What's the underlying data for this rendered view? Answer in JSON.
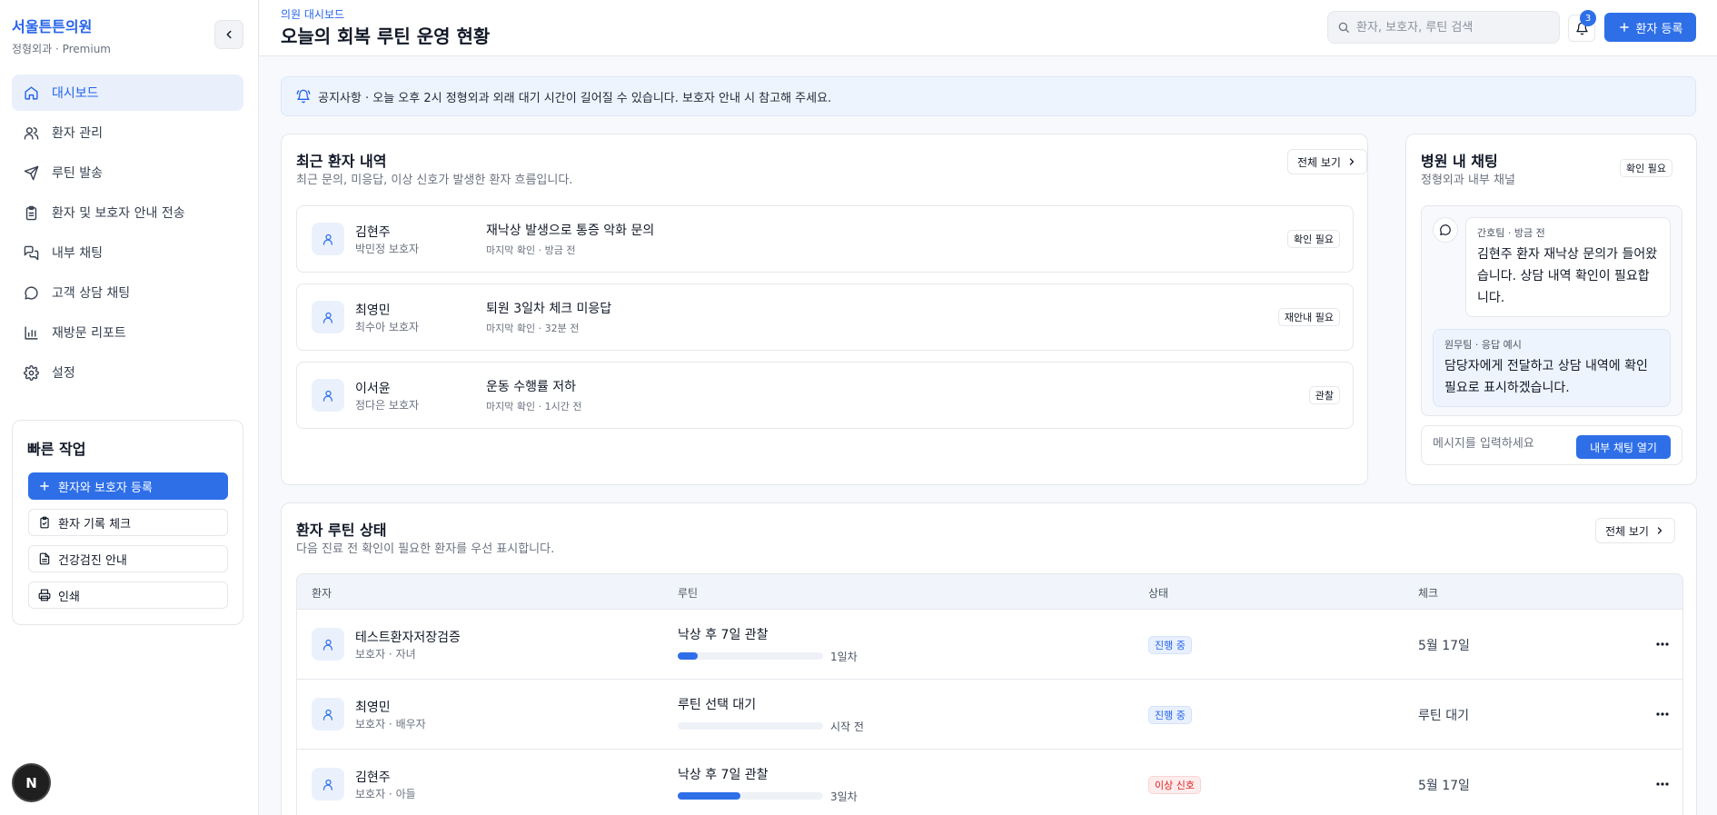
{
  "brand": {
    "name": "서울튼튼의원",
    "sub": "정형외과 · Premium"
  },
  "nav": [
    {
      "label": "대시보드",
      "icon": "home-icon"
    },
    {
      "label": "환자 관리",
      "icon": "users-icon"
    },
    {
      "label": "루틴 발송",
      "icon": "send-icon"
    },
    {
      "label": "환자 및 보호자 안내 전송",
      "icon": "clipboard-icon"
    },
    {
      "label": "내부 채팅",
      "icon": "chat-icon"
    },
    {
      "label": "고객 상담 채팅",
      "icon": "message-circle-icon"
    },
    {
      "label": "재방문 리포트",
      "icon": "bar-chart-icon"
    },
    {
      "label": "설정",
      "icon": "gear-icon"
    }
  ],
  "quick": {
    "title": "빠른 작업",
    "actions": [
      {
        "label": "환자와 보호자 등록",
        "icon": "plus-icon"
      },
      {
        "label": "환자 기록 체크",
        "icon": "clipboard-check-icon"
      },
      {
        "label": "건강검진 안내",
        "icon": "document-icon"
      },
      {
        "label": "인쇄",
        "icon": "printer-icon"
      }
    ]
  },
  "dev_badge": "N",
  "header": {
    "crumb": "의원 대시보드",
    "title": "오늘의 회복 루틴 운영 현황",
    "search_placeholder": "환자, 보호자, 루틴 검색",
    "notification_count": "3",
    "add_patient": "환자 등록"
  },
  "notice": "공지사항 · 오늘 오후 2시 정형외과 외래 대기 시간이 길어질 수 있습니다. 보호자 안내 시 참고해 주세요.",
  "recent": {
    "title": "최근 환자 내역",
    "sub": "최근 문의, 미응답, 이상 신호가 발생한 환자 흐름입니다.",
    "view_all": "전체 보기",
    "rows": [
      {
        "name": "김현주",
        "guardian": "박민정 보호자",
        "issue": "재낙상 발생으로 통증 악화 문의",
        "meta": "마지막 확인 · 방금 전",
        "badge": "확인 필요"
      },
      {
        "name": "최영민",
        "guardian": "최수아 보호자",
        "issue": "퇴원 3일차 체크 미응답",
        "meta": "마지막 확인 · 32분 전",
        "badge": "재안내 필요"
      },
      {
        "name": "이서윤",
        "guardian": "정다은 보호자",
        "issue": "운동 수행률 저하",
        "meta": "마지막 확인 · 1시간 전",
        "badge": "관찰"
      }
    ]
  },
  "chat": {
    "title": "병원 내 채팅",
    "sub": "정형외과 내부 채널",
    "badge": "확인 필요",
    "messages": [
      {
        "meta": "간호팀 · 방금 전",
        "text": "김현주 환자 재낙상 문의가 들어왔습니다. 상담 내역 확인이 필요합니다."
      },
      {
        "meta": "원무팀 · 응답 예시",
        "text": "담당자에게 전달하고 상담 내역에 확인 필요로 표시하겠습니다."
      }
    ],
    "input_placeholder": "메시지를 입력하세요",
    "open_button": "내부 채팅 열기"
  },
  "routine": {
    "title": "환자 루틴 상태",
    "sub": "다음 진료 전 확인이 필요한 환자를 우선 표시합니다.",
    "view_all": "전체 보기",
    "columns": [
      "환자",
      "루틴",
      "상태",
      "체크"
    ],
    "rows": [
      {
        "name": "테스트환자저장검증",
        "relation": "보호자 · 자녀",
        "routine": "낙상 후 7일 관찰",
        "progress": 0.14,
        "progress_label": "1일차",
        "status": "진행 중",
        "status_type": "ongoing",
        "check": "5월 17일"
      },
      {
        "name": "최영민",
        "relation": "보호자 · 배우자",
        "routine": "루틴 선택 대기",
        "progress": 0,
        "progress_label": "시작 전",
        "status": "진행 중",
        "status_type": "ongoing",
        "check": "루틴 대기"
      },
      {
        "name": "김현주",
        "relation": "보호자 · 아들",
        "routine": "낙상 후 7일 관찰",
        "progress": 0.43,
        "progress_label": "3일차",
        "status": "이상 신호",
        "status_type": "warn",
        "check": "5월 17일"
      }
    ]
  },
  "colors": {
    "accent": "#2e6fe8",
    "warn": "#dc2626",
    "active_bg": "#e9f0fb"
  }
}
